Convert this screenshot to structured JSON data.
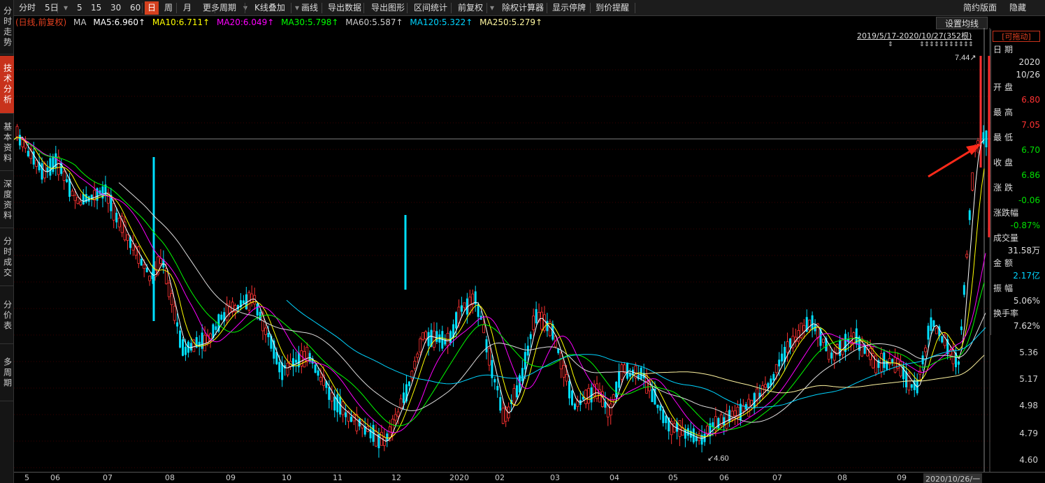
{
  "sidebar": {
    "tabs": [
      {
        "label": "分时走势",
        "active": false
      },
      {
        "label": "技术分析",
        "active": true
      },
      {
        "label": "基本资料",
        "active": false
      },
      {
        "label": "深度资料",
        "active": false
      },
      {
        "label": "分时成交",
        "active": false
      },
      {
        "label": "分价表",
        "active": false
      },
      {
        "label": "多周期",
        "active": false
      }
    ]
  },
  "toolbar": {
    "items": [
      "分时",
      "5日",
      "▾",
      "5",
      "15",
      "30",
      "60",
      "日",
      "周",
      "月",
      "更多周期",
      "▾",
      "K线叠加",
      "▾",
      "画线",
      "导出数据",
      "导出图形",
      "区间统计",
      "前复权",
      "▾",
      "除权计算器",
      "显示停牌",
      "到价提醒"
    ],
    "active_item": "日",
    "right_items": [
      "简约版面",
      "隐藏"
    ]
  },
  "ma_legend": {
    "prefix": "(日线,前复权)",
    "ma_label": "MA",
    "lines": [
      {
        "text": "MA5:6.960↑",
        "color": "#ffffff"
      },
      {
        "text": "MA10:6.711↑",
        "color": "#ffff00"
      },
      {
        "text": "MA20:6.049↑",
        "color": "#ff00ff"
      },
      {
        "text": "MA30:5.798↑",
        "color": "#00ff00"
      },
      {
        "text": "MA60:5.587↑",
        "color": "#cccccc"
      },
      {
        "text": "MA120:5.322↑",
        "color": "#00d4ff"
      },
      {
        "text": "MA250:5.279↑",
        "color": "#fff8a0"
      }
    ]
  },
  "set_ma_button": "设置均线",
  "range_label": "2019/5/17-2020/10/27(352根)",
  "high_marker": "7.44",
  "low_marker": "4.60",
  "info_panel": {
    "title": "[可拖动]",
    "date_label": "日期",
    "year": "2020",
    "date": "10/26",
    "open_label": "开盘",
    "open": "6.80",
    "high_label": "最高",
    "high": "7.05",
    "low_label": "最低",
    "low": "6.70",
    "close_label": "收盘",
    "close": "6.86",
    "change_label": "涨跌",
    "change": "-0.06",
    "change_pct_label": "涨跌幅",
    "change_pct": "-0.87%",
    "volume_label": "成交量",
    "volume": "31.58万",
    "amount_label": "金额",
    "amount": "2.17亿",
    "amplitude_label": "振幅",
    "amplitude": "5.06%",
    "turnover_label": "换手率",
    "turnover": "7.62%"
  },
  "price_axis": [
    "5.36",
    "5.17",
    "4.98",
    "4.79",
    "4.60"
  ],
  "date_axis": [
    "5",
    "06",
    "07",
    "08",
    "09",
    "10",
    "11",
    "12",
    "2020",
    "02",
    "03",
    "04",
    "05",
    "06",
    "07",
    "08",
    "09",
    "2020/10/26/一"
  ],
  "colors": {
    "up": "#ff3232",
    "down": "#00e0ff",
    "active_tab": "#d4401e",
    "annotation_arrow": "#ff2a1a"
  }
}
